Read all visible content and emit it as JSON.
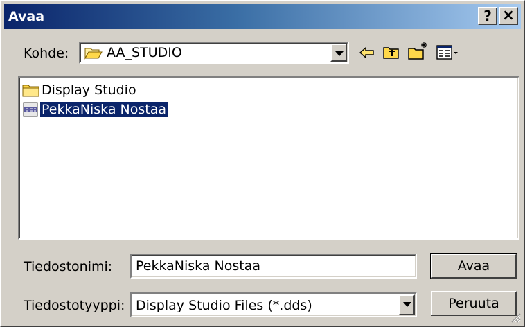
{
  "window": {
    "title": "Avaa",
    "help_label": "?",
    "close_label": "×"
  },
  "location": {
    "label": "Kohde:",
    "current_folder": "AA_STUDIO"
  },
  "toolbar": {
    "icons": [
      "back-arrow-icon",
      "up-one-level-icon",
      "new-folder-icon",
      "view-menu-icon"
    ]
  },
  "files": [
    {
      "name": "Display Studio",
      "type": "folder"
    },
    {
      "name": "PekkaNiska Nostaa",
      "type": "dds-file"
    }
  ],
  "filename": {
    "label": "Tiedostonimi:",
    "value": "PekkaNiska Nostaa"
  },
  "filetype": {
    "label": "Tiedostotyyppi:",
    "value": "Display Studio Files (*.dds)"
  },
  "buttons": {
    "open": "Avaa",
    "cancel": "Peruuta"
  },
  "colors": {
    "titlebar_start": "#0a246a",
    "titlebar_end": "#a6caf0",
    "dialog_face": "#d4d0c8",
    "selection": "#0a246a"
  }
}
